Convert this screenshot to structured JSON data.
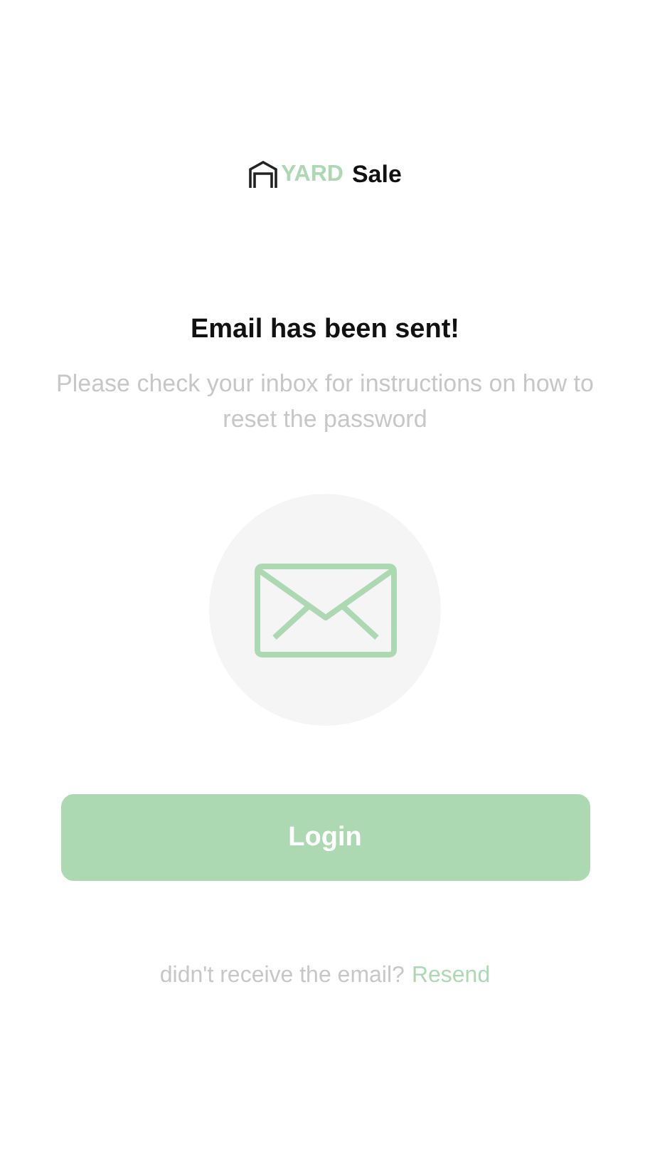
{
  "logo": {
    "brand": "YARD",
    "word": "Sale"
  },
  "title": "Email has been sent!",
  "subtitle": "Please check your inbox for instructions on how to reset the password",
  "login_button": "Login",
  "footer": {
    "text": "didn't receive the email?",
    "link": "Resend"
  }
}
